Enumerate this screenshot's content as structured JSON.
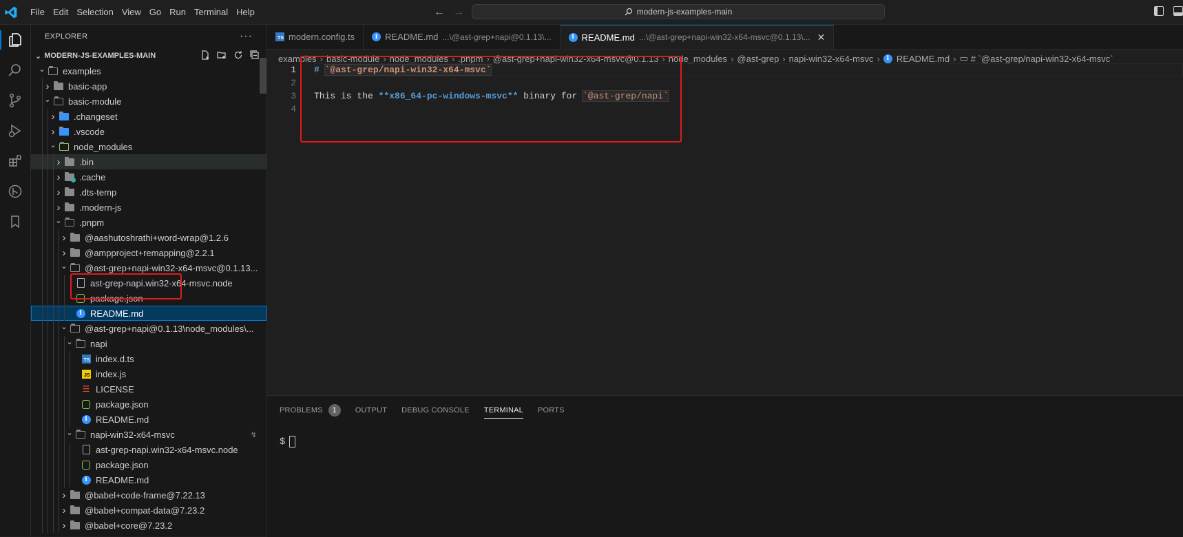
{
  "menu": [
    "File",
    "Edit",
    "Selection",
    "View",
    "Go",
    "Run",
    "Terminal",
    "Help"
  ],
  "command_center": "modern-js-examples-main",
  "explorer": {
    "title": "EXPLORER",
    "root": "MODERN-JS-EXAMPLES-MAIN",
    "tree": [
      {
        "label": "examples",
        "depth": 0,
        "kind": "folder-open",
        "chev": "down",
        "badge": true
      },
      {
        "label": "basic-app",
        "depth": 1,
        "kind": "folder",
        "chev": "right"
      },
      {
        "label": "basic-module",
        "depth": 1,
        "kind": "folder-open",
        "chev": "down"
      },
      {
        "label": ".changeset",
        "depth": 2,
        "kind": "folder-special",
        "chev": "right"
      },
      {
        "label": ".vscode",
        "depth": 2,
        "kind": "folder-vscode",
        "chev": "right"
      },
      {
        "label": "node_modules",
        "depth": 2,
        "kind": "folder-node",
        "chev": "down"
      },
      {
        "label": ".bin",
        "depth": 3,
        "kind": "folder",
        "chev": "right",
        "hover": true
      },
      {
        "label": ".cache",
        "depth": 3,
        "kind": "folder-cache",
        "chev": "right"
      },
      {
        "label": ".dts-temp",
        "depth": 3,
        "kind": "folder",
        "chev": "right"
      },
      {
        "label": ".modern-js",
        "depth": 3,
        "kind": "folder",
        "chev": "right"
      },
      {
        "label": ".pnpm",
        "depth": 3,
        "kind": "folder-open",
        "chev": "down"
      },
      {
        "label": "@aashutoshrathi+word-wrap@1.2.6",
        "depth": 4,
        "kind": "folder",
        "chev": "right"
      },
      {
        "label": "@ampproject+remapping@2.2.1",
        "depth": 4,
        "kind": "folder",
        "chev": "right"
      },
      {
        "label": "@ast-grep+napi-win32-x64-msvc@0.1.13...",
        "depth": 4,
        "kind": "folder-open",
        "chev": "down"
      },
      {
        "label": "ast-grep-napi.win32-x64-msvc.node",
        "depth": 5,
        "kind": "file",
        "chev": ""
      },
      {
        "label": "package.json",
        "depth": 5,
        "kind": "pkg",
        "chev": ""
      },
      {
        "label": "README.md",
        "depth": 5,
        "kind": "info",
        "chev": "",
        "selected": true
      },
      {
        "label": "@ast-grep+napi@0.1.13\\node_modules\\...",
        "depth": 4,
        "kind": "folder-open",
        "chev": "down"
      },
      {
        "label": "napi",
        "depth": 5,
        "kind": "folder-open",
        "chev": "down"
      },
      {
        "label": "index.d.ts",
        "depth": 6,
        "kind": "ts",
        "chev": ""
      },
      {
        "label": "index.js",
        "depth": 6,
        "kind": "js",
        "chev": ""
      },
      {
        "label": "LICENSE",
        "depth": 6,
        "kind": "license",
        "chev": ""
      },
      {
        "label": "package.json",
        "depth": 6,
        "kind": "pkg",
        "chev": ""
      },
      {
        "label": "README.md",
        "depth": 6,
        "kind": "info",
        "chev": ""
      },
      {
        "label": "napi-win32-x64-msvc",
        "depth": 5,
        "kind": "folder-open",
        "chev": "down",
        "sync": true
      },
      {
        "label": "ast-grep-napi.win32-x64-msvc.node",
        "depth": 6,
        "kind": "file",
        "chev": ""
      },
      {
        "label": "package.json",
        "depth": 6,
        "kind": "pkg",
        "chev": ""
      },
      {
        "label": "README.md",
        "depth": 6,
        "kind": "info",
        "chev": ""
      },
      {
        "label": "@babel+code-frame@7.22.13",
        "depth": 4,
        "kind": "folder",
        "chev": "right"
      },
      {
        "label": "@babel+compat-data@7.23.2",
        "depth": 4,
        "kind": "folder",
        "chev": "right"
      },
      {
        "label": "@babel+core@7.23.2",
        "depth": 4,
        "kind": "folder",
        "chev": "right"
      }
    ]
  },
  "tabs": [
    {
      "label": "modern.config.ts",
      "desc": "",
      "icon": "ts",
      "active": false
    },
    {
      "label": "README.md",
      "desc": "...\\@ast-grep+napi@0.1.13\\...",
      "icon": "info",
      "active": false
    },
    {
      "label": "README.md",
      "desc": "...\\@ast-grep+napi-win32-x64-msvc@0.1.13\\...",
      "icon": "info",
      "active": true
    }
  ],
  "breadcrumb": [
    "examples",
    "basic-module",
    "node_modules",
    ".pnpm",
    "@ast-grep+napi-win32-x64-msvc@0.1.13",
    "node_modules",
    "@ast-grep",
    "napi-win32-x64-msvc",
    "README.md",
    "# `@ast-grep/napi-win32-x64-msvc`"
  ],
  "code": {
    "line_numbers": [
      "1",
      "2",
      "3",
      "4"
    ],
    "l1_hash": "# ",
    "l1_code": "`@ast-grep/napi-win32-x64-msvc`",
    "l3_a": "This is the ",
    "l3_bold": "**x86_64-pc-windows-msvc**",
    "l3_b": " binary for ",
    "l3_code": "`@ast-grep/napi`"
  },
  "panel": {
    "tabs": [
      "PROBLEMS",
      "OUTPUT",
      "DEBUG CONSOLE",
      "TERMINAL",
      "PORTS"
    ],
    "problems_count": "1",
    "active": "TERMINAL",
    "prompt": "$"
  }
}
